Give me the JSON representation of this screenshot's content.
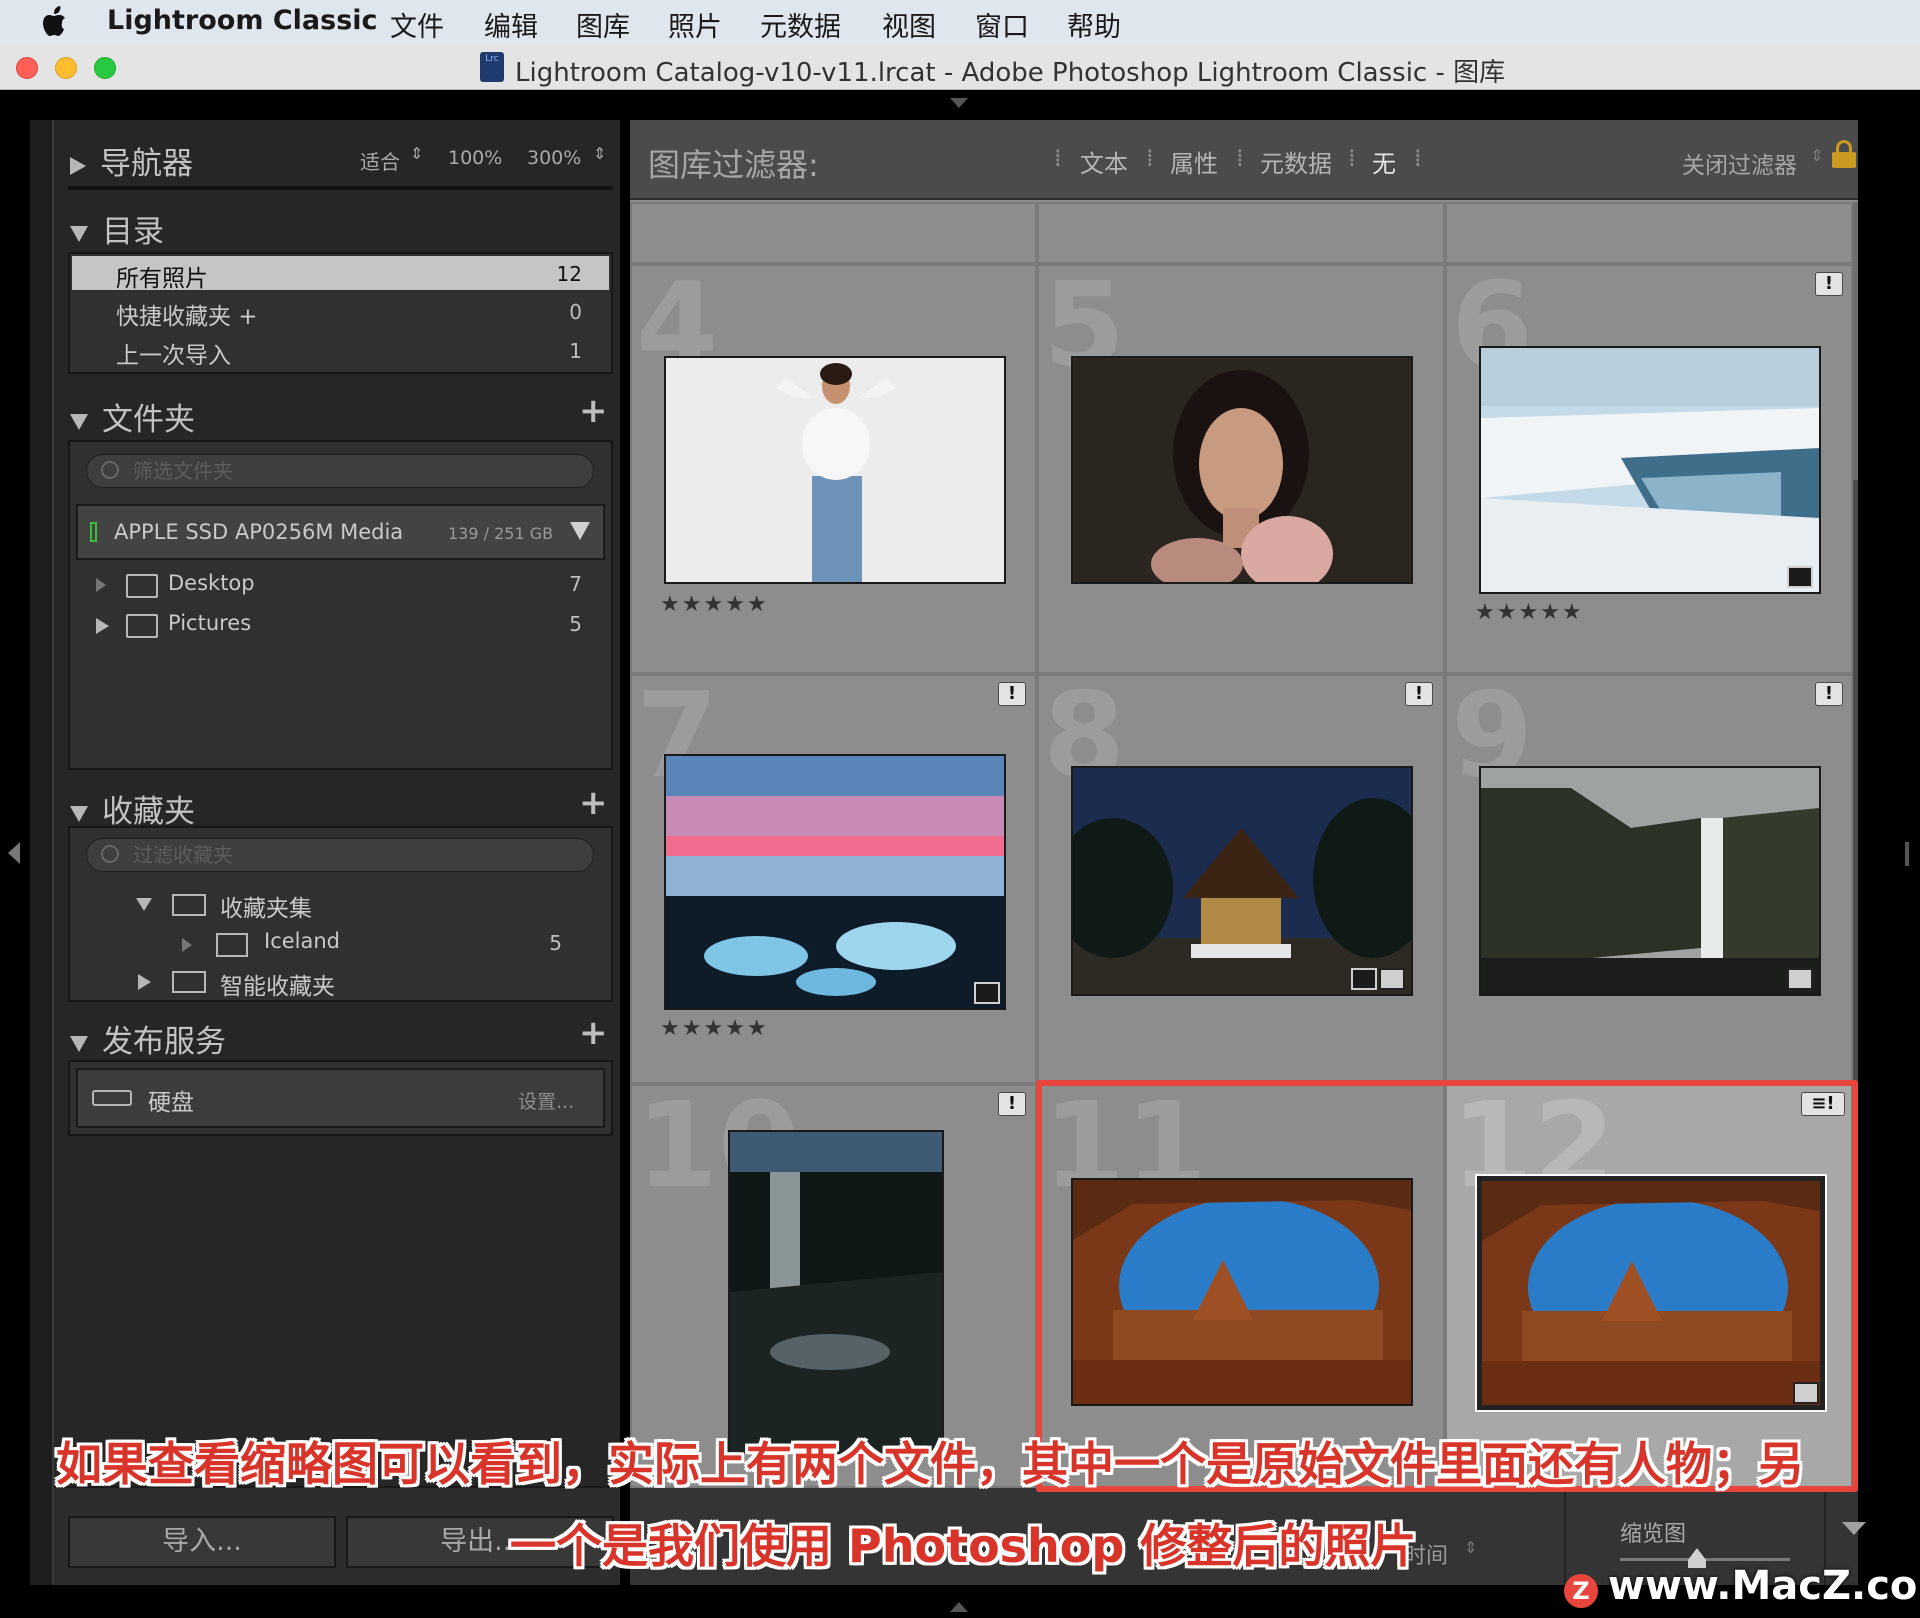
{
  "menubar": {
    "app_name": "Lightroom Classic",
    "items": [
      "文件",
      "编辑",
      "图库",
      "照片",
      "元数据",
      "视图",
      "窗口",
      "帮助"
    ]
  },
  "window": {
    "title": "Lightroom Catalog-v10-v11.lrcat - Adobe Photoshop Lightroom Classic - 图库",
    "doc_icon_label": "Lrc"
  },
  "navigator": {
    "title": "导航器",
    "zoom_fit": "适合",
    "zoom_100": "100%",
    "zoom_300": "300%"
  },
  "catalog": {
    "title": "目录",
    "items": [
      {
        "label": "所有照片",
        "count": "12"
      },
      {
        "label": "快捷收藏夹 +",
        "count": "0"
      },
      {
        "label": "上一次导入",
        "count": "1"
      }
    ]
  },
  "folders": {
    "title": "文件夹",
    "filter_placeholder": "筛选文件夹",
    "volume_name": "APPLE SSD AP0256M Media",
    "volume_size": "139 / 251 GB",
    "items": [
      {
        "label": "Desktop",
        "count": "7"
      },
      {
        "label": "Pictures",
        "count": "5"
      }
    ]
  },
  "collections": {
    "title": "收藏夹",
    "filter_placeholder": "过滤收藏夹",
    "set_label": "收藏夹集",
    "child_label": "Iceland",
    "child_count": "5",
    "smart_label": "智能收藏夹"
  },
  "publish": {
    "title": "发布服务",
    "service_label": "硬盘",
    "setup_label": "设置..."
  },
  "left_bottom": {
    "import_label": "导入...",
    "export_label": "导出..."
  },
  "filter_bar": {
    "title": "图库过滤器:",
    "options": [
      "文本",
      "属性",
      "元数据",
      "无"
    ],
    "close_label": "关闭过滤器"
  },
  "grid": {
    "cells": [
      {
        "num": "4",
        "stars": "★★★★★"
      },
      {
        "num": "5",
        "stars": ""
      },
      {
        "num": "6",
        "stars": "★★★★★"
      },
      {
        "num": "7",
        "stars": "★★★★★"
      },
      {
        "num": "8",
        "stars": ""
      },
      {
        "num": "9",
        "stars": ""
      },
      {
        "num": "10",
        "stars": ""
      },
      {
        "num": "11",
        "stars": ""
      },
      {
        "num": "12",
        "stars": ""
      }
    ]
  },
  "toolbar": {
    "sort_label": "时间",
    "thumb_label": "缩览图"
  },
  "annotation": {
    "line1": "如果查看缩略图可以看到，实际上有两个文件，其中一个是原始文件里面还有人物；另",
    "line2": "一个是我们使用 Photoshop 修整后的照片"
  },
  "watermark": "www.MacZ.com",
  "colors": {
    "highlight_box": "#e8453c",
    "annotation_text": "#d8342a",
    "volume_indicator": "#3dbb3d"
  }
}
